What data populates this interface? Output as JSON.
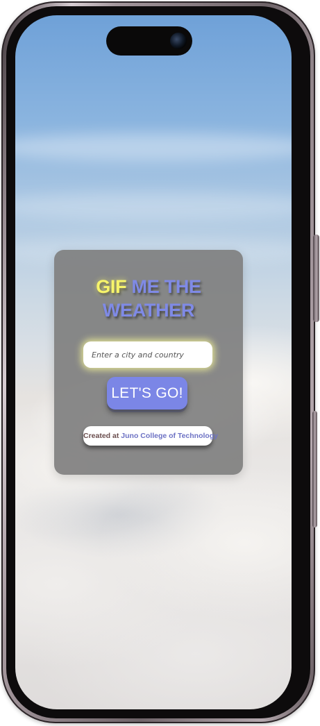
{
  "app": {
    "title_highlight": "GIF",
    "title_rest_line1": "ME THE",
    "title_rest_line2": "WEATHER"
  },
  "search": {
    "placeholder": "Enter a city and country",
    "value": ""
  },
  "go_button": {
    "label": "LET'S GO!"
  },
  "credit": {
    "prefix": "Created at ",
    "link_text": "Juno College of Technology"
  },
  "colors": {
    "title_highlight": "#f7f46a",
    "title_rest": "#7f8ae6",
    "button": "#7b86e6",
    "card": "#808080"
  }
}
